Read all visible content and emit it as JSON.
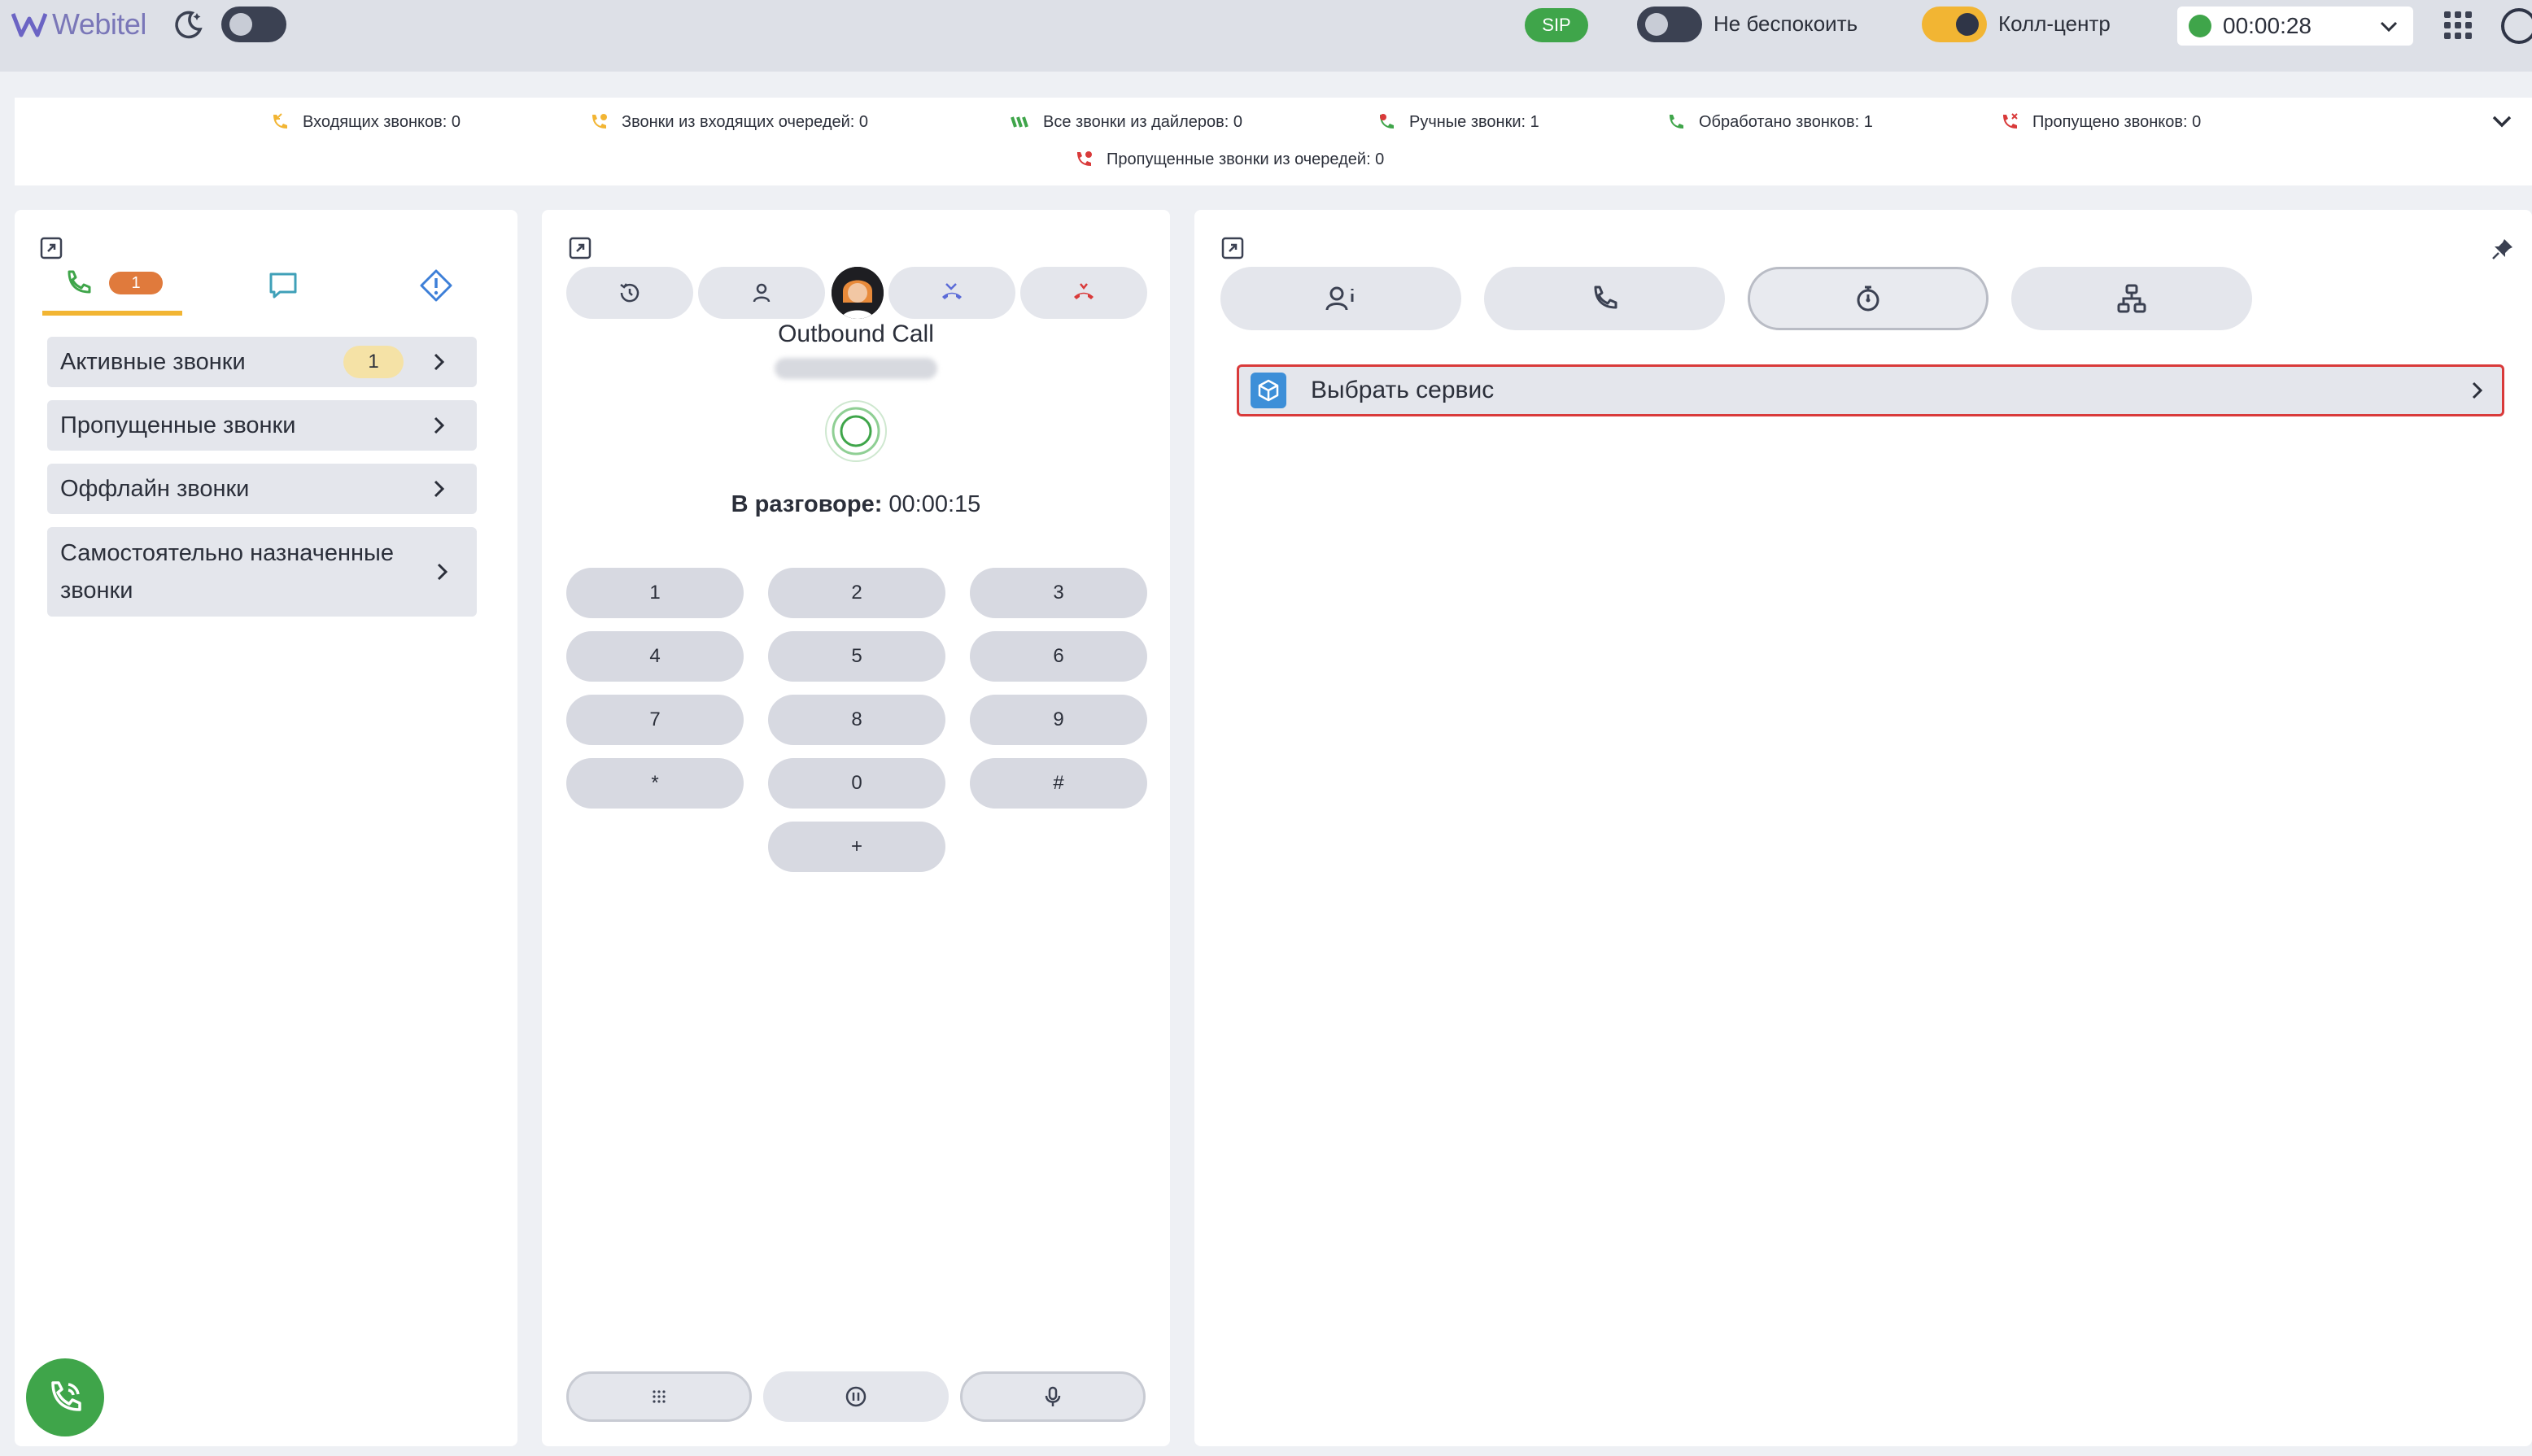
{
  "app": {
    "brand": "Webitel"
  },
  "topbar": {
    "sip_label": "SIP",
    "dnd_label": "Не беспокоить",
    "callcenter_label": "Колл-центр",
    "status_timer": "00:00:28",
    "status_color": "#3fa54a",
    "theme_toggle_on": false,
    "dnd_toggle_on": false,
    "callcenter_toggle_on": true
  },
  "stats": {
    "incoming": "Входящих звонков: 0",
    "queue_incoming": "Звонки из входящих очередей: 0",
    "dialer_all": "Все звонки из дайлеров: 0",
    "manual": "Ручные звонки: 1",
    "processed": "Обработано звонков: 1",
    "missed": "Пропущено звонков: 0",
    "queue_missed": "Пропущенные звонки из очередей: 0"
  },
  "left_panel": {
    "calls_tab_count": "1",
    "items": [
      {
        "label": "Активные звонки",
        "badge": "1"
      },
      {
        "label": "Пропущенные звонки"
      },
      {
        "label": "Оффлайн звонки"
      },
      {
        "label": "Самостоятельно назначенные звонки"
      }
    ]
  },
  "call": {
    "title": "Outbound Call",
    "talk_label": "В разговоре:",
    "talk_time": "00:00:15"
  },
  "dialpad": {
    "keys": [
      "1",
      "2",
      "3",
      "4",
      "5",
      "6",
      "7",
      "8",
      "9",
      "*",
      "0",
      "#",
      "+"
    ]
  },
  "right_panel": {
    "service_label": "Выбрать сервис"
  },
  "colors": {
    "accent_yellow": "#f2b533",
    "green": "#3fa54a",
    "red": "#d93a3a",
    "orange": "#e07a3c"
  }
}
